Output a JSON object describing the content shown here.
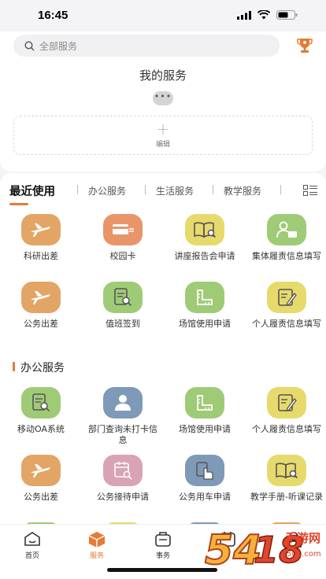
{
  "status_bar": {
    "time": "16:45"
  },
  "search": {
    "placeholder": "全部服务"
  },
  "my_services": {
    "title": "我的服务",
    "more": "•••",
    "edit_label": "编辑"
  },
  "tabs": [
    {
      "label": "最近使用",
      "active": true
    },
    {
      "label": "办公服务"
    },
    {
      "label": "生活服务"
    },
    {
      "label": "教学服务"
    }
  ],
  "recent_items": [
    {
      "label": "科研出差",
      "icon": "airplane-icon",
      "color": "#e3a565"
    },
    {
      "label": "校园卡",
      "icon": "card-icon",
      "color": "#e9956a"
    },
    {
      "label": "讲座报告会申请",
      "icon": "book-search-icon",
      "color": "#e7da6c"
    },
    {
      "label": "集体履责信息填写",
      "icon": "user-card-icon",
      "color": "#9fcb76"
    },
    {
      "label": "公务出差",
      "icon": "airplane-icon",
      "color": "#e3a565"
    },
    {
      "label": "值班签到",
      "icon": "document-search-icon",
      "color": "#9fcb76"
    },
    {
      "label": "场馆使用申请",
      "icon": "ruler-icon",
      "color": "#9fcb76"
    },
    {
      "label": "个人履责信息填写",
      "icon": "edit-document-icon",
      "color": "#e7da6c"
    }
  ],
  "office_section": {
    "title": "办公服务",
    "items": [
      {
        "label": "移动OA系统",
        "icon": "document-search-icon",
        "color": "#9fcb76"
      },
      {
        "label": "部门查询未打卡信息",
        "icon": "user-icon",
        "color": "#7f9ab8"
      },
      {
        "label": "场馆使用申请",
        "icon": "ruler-icon",
        "color": "#9fcb76"
      },
      {
        "label": "个人履责信息填写",
        "icon": "edit-document-icon",
        "color": "#e7da6c"
      },
      {
        "label": "公务出差",
        "icon": "airplane-icon",
        "color": "#e3a565"
      },
      {
        "label": "公务接待申请",
        "icon": "calendar-search-icon",
        "color": "#d9a3b5"
      },
      {
        "label": "公务用车申请",
        "icon": "hand-document-icon",
        "color": "#7f9ab8"
      },
      {
        "label": "教学手册-听课记录",
        "icon": "book-search-icon",
        "color": "#e7da6c"
      }
    ]
  },
  "bottom_nav": [
    {
      "label": "首页",
      "icon": "home-icon"
    },
    {
      "label": "服务",
      "icon": "box-icon",
      "active": true
    },
    {
      "label": "事务",
      "icon": "briefcase-icon"
    },
    {
      "label": "",
      "icon": "calendar-icon"
    },
    {
      "label": "",
      "icon": "person-icon"
    }
  ],
  "watermark": {
    "text": "5418手游网",
    "url": "5u1.com"
  },
  "colors": {
    "accent": "#e67a34",
    "background": "#f4f4f6"
  }
}
